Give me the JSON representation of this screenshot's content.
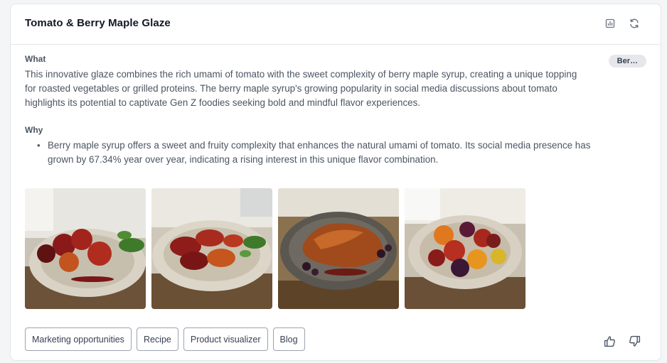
{
  "card": {
    "title": "Tomato & Berry Maple Glaze",
    "header_icons": [
      "chart-icon",
      "refresh-icon"
    ],
    "tag": "Ber…"
  },
  "what": {
    "label": "What",
    "text": "This innovative glaze combines the rich umami of tomato with the sweet complexity of berry maple syrup, creating a unique topping for roasted vegetables or grilled proteins. The berry maple syrup's growing popularity in social media discussions about tomato highlights its potential to captivate Gen Z foodies seeking bold and mindful flavor experiences."
  },
  "why": {
    "label": "Why",
    "bullets": [
      "Berry maple syrup offers a sweet and fruity complexity that enhances the natural umami of tomato. Its social media presence has grown by 67.34% year over year, indicating a rising interest in this unique flavor combination."
    ]
  },
  "images": [
    {
      "subject": "glazed-tomatoes-plate"
    },
    {
      "subject": "glazed-sliced-tomatoes-plate"
    },
    {
      "subject": "glazed-chicken-plate"
    },
    {
      "subject": "roasted-heirloom-tomatoes-plate"
    }
  ],
  "actions": {
    "chips": [
      "Marketing opportunities",
      "Recipe",
      "Product visualizer",
      "Blog"
    ],
    "feedback_icons": [
      "thumbs-up-icon",
      "thumbs-down-icon"
    ]
  },
  "colors": {
    "accent_pill_bg": "#e5e7eb",
    "text_muted": "#4b5563",
    "border": "#e3e5e9"
  }
}
